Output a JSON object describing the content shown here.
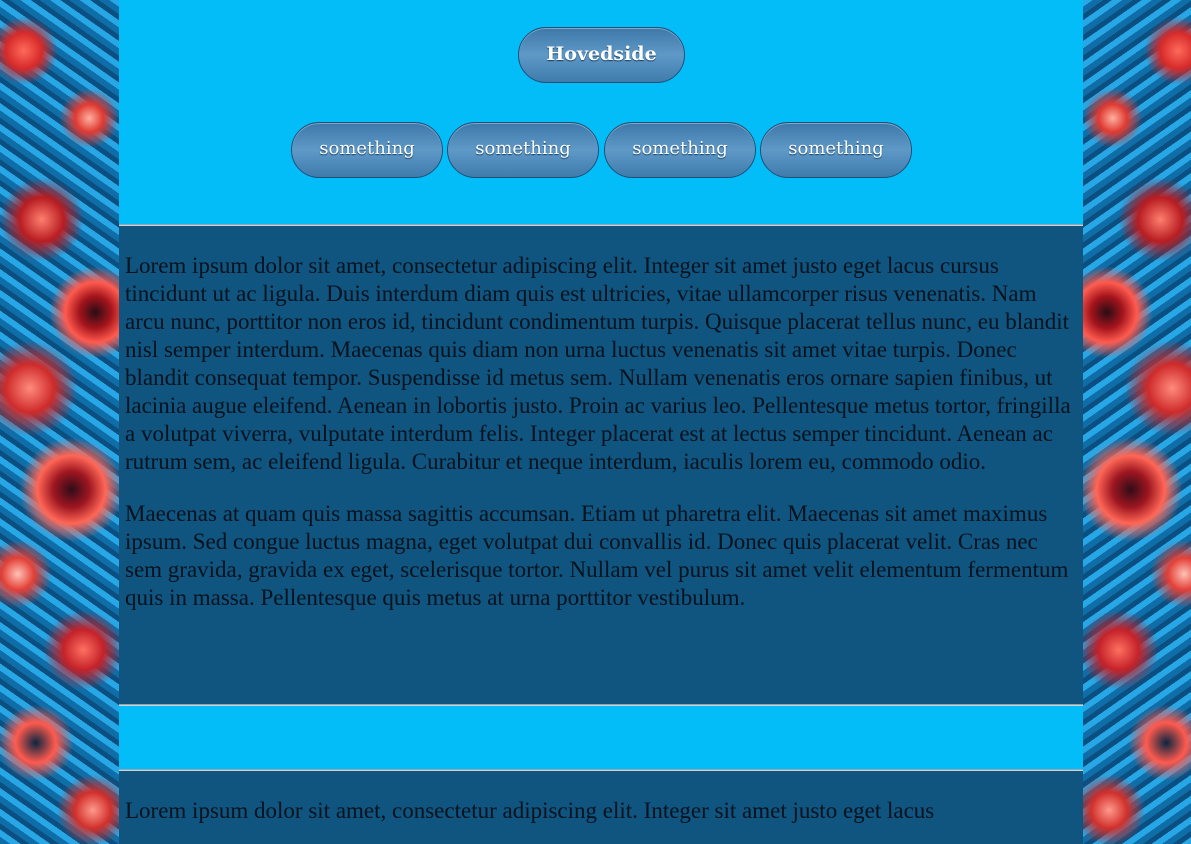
{
  "header": {
    "main_button": "Hovedside",
    "nav": [
      "something",
      "something",
      "something",
      "something"
    ]
  },
  "section1": {
    "paragraphs": [
      "Lorem ipsum dolor sit amet, consectetur adipiscing elit. Integer sit amet justo eget lacus cursus tincidunt ut ac ligula. Duis interdum diam quis est ultricies, vitae ullamcorper risus venenatis. Nam arcu nunc, porttitor non eros id, tincidunt condimentum turpis. Quisque placerat tellus nunc, eu blandit nisl semper interdum. Maecenas quis diam non urna luctus venenatis sit amet vitae turpis. Donec blandit consequat tempor. Suspendisse id metus sem. Nullam venenatis eros ornare sapien finibus, ut lacinia augue eleifend. Aenean in lobortis justo. Proin ac varius leo. Pellentesque metus tortor, fringilla a volutpat viverra, vulputate interdum felis. Integer placerat est at lectus semper tincidunt. Aenean ac rutrum sem, ac eleifend ligula. Curabitur et neque interdum, iaculis lorem eu, commodo odio.",
      "Maecenas at quam quis massa sagittis accumsan. Etiam ut pharetra elit. Maecenas sit amet maximus ipsum. Sed congue luctus magna, eget volutpat dui convallis id. Donec quis placerat velit. Cras nec sem gravida, gravida ex eget, scelerisque tortor. Nullam vel purus sit amet velit elementum fermentum quis in massa. Pellentesque quis metus at urna porttitor vestibulum."
    ]
  },
  "section2": {
    "paragraphs": [
      "Lorem ipsum dolor sit amet, consectetur adipiscing elit. Integer sit amet justo eget lacus"
    ]
  },
  "colors": {
    "header_bg": "#02bdf7",
    "content_bg": "#0f557f",
    "button_bg": "#4f8bbb"
  }
}
